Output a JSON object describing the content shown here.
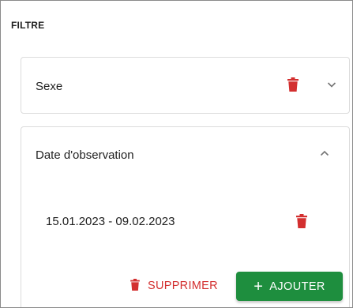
{
  "filter": {
    "title": "FILTRE",
    "sections": [
      {
        "label": "Sexe",
        "expanded": false
      },
      {
        "label": "Date d'observation",
        "expanded": true,
        "range": "15.01.2023 - 09.02.2023"
      }
    ],
    "actions": {
      "delete_label": "SUPPRIMER",
      "add_label": "AJOUTER",
      "add_prefix": "+"
    }
  },
  "colors": {
    "danger": "#d32f2f",
    "primary": "#1e8e3e",
    "chevron": "#757575"
  },
  "icons": {
    "delete": "trash-icon",
    "collapse": "chevron-up-icon",
    "expand": "chevron-down-icon",
    "add": "plus-icon"
  }
}
